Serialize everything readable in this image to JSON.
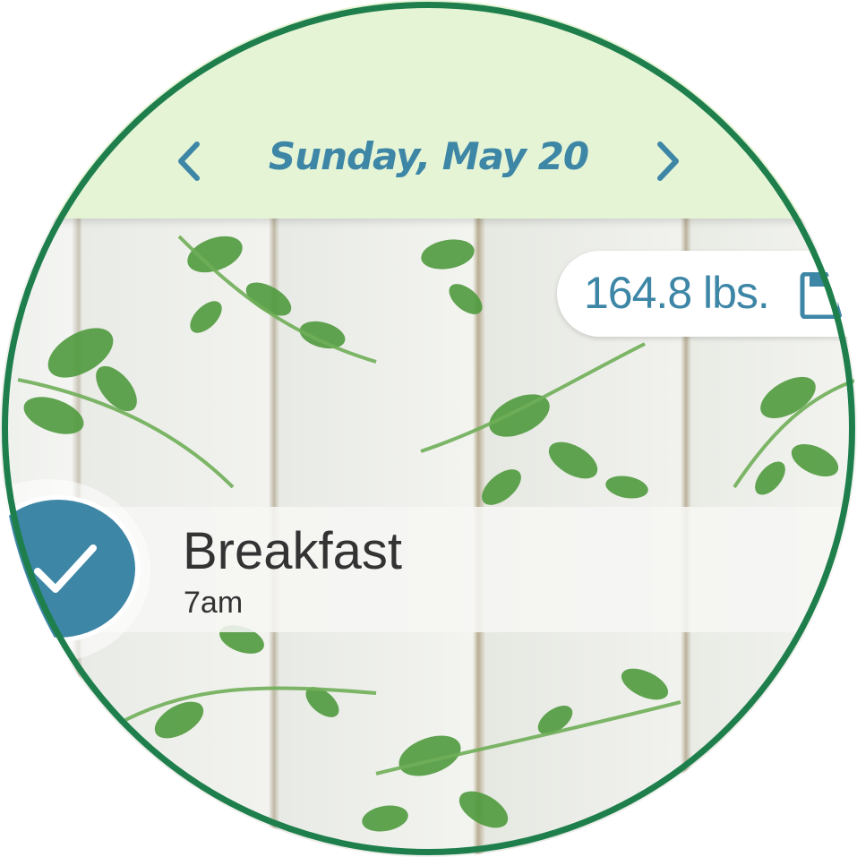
{
  "header": {
    "date_title": "Sunday, May 20"
  },
  "weight": {
    "value_text": "164.8 lbs."
  },
  "meal": {
    "name": "Breakfast",
    "time": "7am",
    "completed": true
  },
  "colors": {
    "header_bg": "#e6f4d6",
    "accent_blue": "#3d86a6",
    "ring_green": "#1e7f4c",
    "text_dark": "#333333"
  },
  "icons": {
    "prev": "chevron-left-icon",
    "next": "chevron-right-icon",
    "save": "save-icon",
    "check": "check-icon"
  }
}
